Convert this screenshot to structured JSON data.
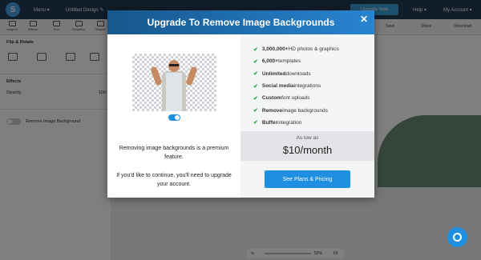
{
  "app": {
    "logo_letter": "S",
    "menu_label": "Menu ▾",
    "doc_title": "Untitled Design ✎",
    "upgrade_button": "Upgrade Now",
    "help_label": "Help ▾",
    "account_label": "My Account ▾"
  },
  "toolbar": {
    "tools": [
      {
        "label": "Magnet"
      },
      {
        "label": "Effects"
      },
      {
        "label": "Text"
      },
      {
        "label": "Graphics"
      },
      {
        "label": "Shapes"
      }
    ],
    "save_label": "Save",
    "share_label": "Share",
    "download_label": "Download"
  },
  "sidebar": {
    "flip_rotate": "Flip & Rotate",
    "effects": "Effects",
    "opacity_label": "Opacity",
    "opacity_value": "100",
    "remove_bg_label": "Remove Image Background"
  },
  "canvas": {
    "zoom_value": "52%",
    "fit_label": "Fit"
  },
  "modal": {
    "title": "Upgrade To Remove Image Backgrounds",
    "close": "✕",
    "left_text_1": "Removing image backgrounds is a premium feature.",
    "left_text_2": "If you'd like to continue, you'll need to upgrade your account.",
    "features": [
      {
        "bold": "3,000,000+",
        "rest": " HD photos & graphics"
      },
      {
        "bold": "6,000+",
        "rest": " templates"
      },
      {
        "bold": "Unlimited",
        "rest": " downloads"
      },
      {
        "bold": "Social media",
        "rest": " integrations"
      },
      {
        "bold": "Custom",
        "rest": " font uploads"
      },
      {
        "bold": "Remove",
        "rest": " image backgrounds"
      },
      {
        "bold": "Buffer",
        "rest": " integration"
      }
    ],
    "price_prefix": "As low as",
    "price": "$10/month",
    "cta": "See Plans & Pricing"
  },
  "colors": {
    "header_start": "#17578c",
    "header_end": "#2884d0",
    "accent": "#1f8fe2",
    "check": "#27a844"
  }
}
